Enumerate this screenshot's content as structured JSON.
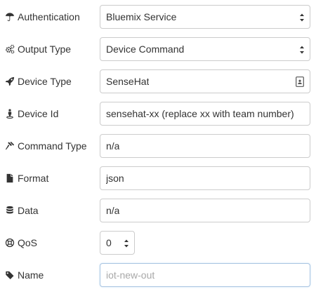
{
  "fields": {
    "authentication": {
      "label": "Authentication",
      "icon": "umbrella-icon",
      "value": "Bluemix Service"
    },
    "output_type": {
      "label": "Output Type",
      "icon": "cogs-icon",
      "value": "Device Command"
    },
    "device_type": {
      "label": "Device Type",
      "icon": "rocket-icon",
      "value": "SenseHat"
    },
    "device_id": {
      "label": "Device Id",
      "icon": "street-view-icon",
      "value": "sensehat-xx (replace xx with team number)"
    },
    "command_type": {
      "label": "Command Type",
      "icon": "gavel-icon",
      "value": "n/a"
    },
    "format": {
      "label": "Format",
      "icon": "file-icon",
      "value": "json"
    },
    "data": {
      "label": "Data",
      "icon": "database-icon",
      "value": "n/a"
    },
    "qos": {
      "label": "QoS",
      "icon": "life-ring-icon",
      "value": "0"
    },
    "name": {
      "label": "Name",
      "icon": "tag-icon",
      "value": "",
      "placeholder": "iot-new-out"
    }
  },
  "colors": {
    "border": "#cccccc",
    "focus_border": "#a9c5e2",
    "text": "#333333",
    "placeholder": "#a8a8a8"
  }
}
